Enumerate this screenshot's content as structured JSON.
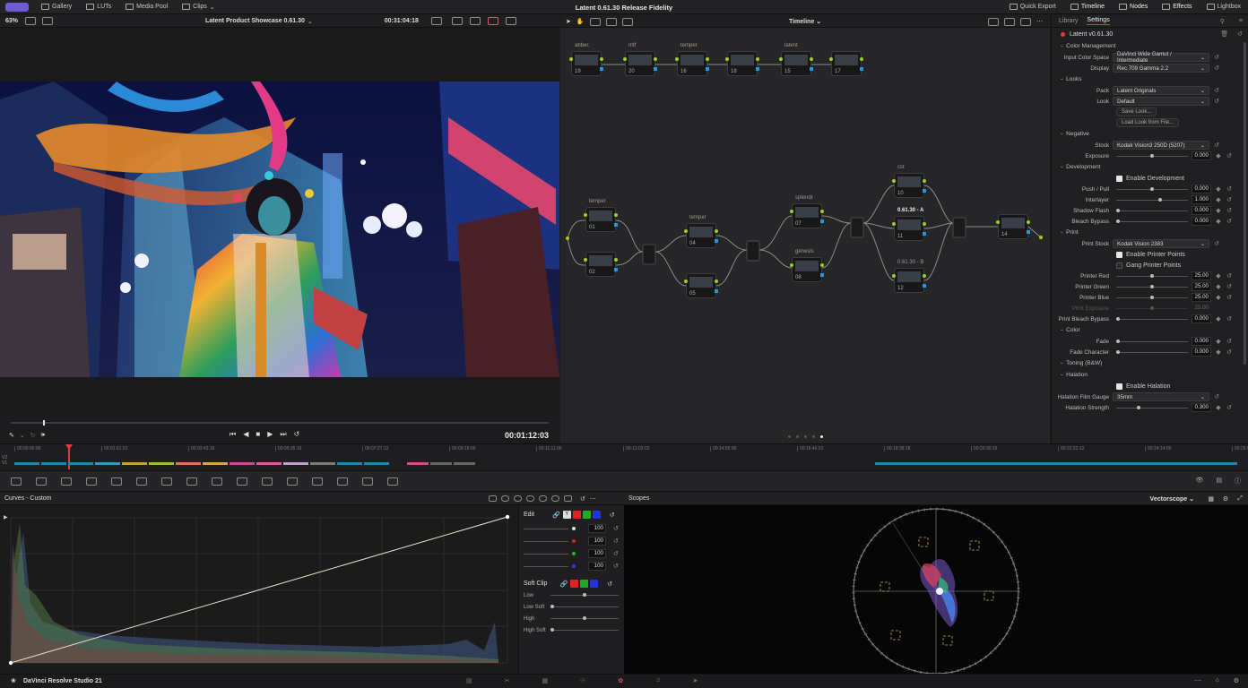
{
  "app": {
    "title": "Latent 0.61.30 Release Fidelity",
    "product": "DaVinci Resolve Studio 21"
  },
  "topnav": {
    "left": [
      {
        "label": "Gallery"
      },
      {
        "label": "LUTs"
      },
      {
        "label": "Media Pool"
      },
      {
        "label": "Clips"
      }
    ],
    "right": [
      {
        "label": "Quick Export"
      },
      {
        "label": "Timeline"
      },
      {
        "label": "Nodes"
      },
      {
        "label": "Effects"
      },
      {
        "label": "Lightbox"
      }
    ]
  },
  "viewer": {
    "zoom": "63%",
    "clip_name": "Latent Product Showcase 0.61.30",
    "timecode": "00:31:04:18",
    "playhead_timecode": "00:01:12:03",
    "timeline_label": "Timeline",
    "scrub_position": 0.06
  },
  "nodes": {
    "pager_dots": 5,
    "active_dot": 4,
    "items": [
      {
        "num": "19",
        "label": "abber."
      },
      {
        "num": "20",
        "label": "mtf"
      },
      {
        "num": "16",
        "label": "temper"
      },
      {
        "num": "18",
        "label": ""
      },
      {
        "num": "15",
        "label": "latent"
      },
      {
        "num": "17",
        "label": ""
      },
      {
        "num": "01",
        "label": "temper"
      },
      {
        "num": "02",
        "label": ""
      },
      {
        "num": "04",
        "label": "temper"
      },
      {
        "num": "05",
        "label": ""
      },
      {
        "num": "07",
        "label": "splendr"
      },
      {
        "num": "08",
        "label": "genesis"
      },
      {
        "num": "10",
        "label": "cst"
      },
      {
        "num": "11",
        "label": "0.61.30 - A"
      },
      {
        "num": "12",
        "label": "0.61.30 - B"
      },
      {
        "num": "14",
        "label": ""
      }
    ]
  },
  "settings": {
    "tabs": [
      {
        "label": "Library"
      },
      {
        "label": "Settings"
      }
    ],
    "plugin_name": "Latent v0.61.30",
    "sections": {
      "color_management": "Color Management",
      "looks": "Looks",
      "negative": "Negative",
      "development": "Development",
      "print": "Print",
      "color": "Color",
      "toning": "Toning (B&W)",
      "halation": "Halation"
    },
    "input_color_space": {
      "label": "Input Color Space",
      "value": "DaVinci Wide Gamut / Intermediate"
    },
    "display": {
      "label": "Display",
      "value": "Rec.709 Gamma 2.2"
    },
    "pack": {
      "label": "Pack",
      "value": "Latent Originals"
    },
    "look": {
      "label": "Look",
      "value": "Default"
    },
    "save_look": "Save Look...",
    "load_look": "Load Look from File...",
    "stock": {
      "label": "Stock",
      "value": "Kodak Vision3 250D (5207)"
    },
    "exposure": {
      "label": "Exposure",
      "value": "0.000",
      "level": 0.5
    },
    "enable_development": {
      "label": "Enable Development",
      "checked": true
    },
    "push_pull": {
      "label": "Push / Pull",
      "value": "0.000",
      "level": 0.5
    },
    "interlayer": {
      "label": "Interlayer",
      "value": "1.000",
      "level": 0.62
    },
    "shadow_flash": {
      "label": "Shadow Flash",
      "value": "0.000",
      "level": 0.0
    },
    "bleach_bypass": {
      "label": "Bleach Bypass",
      "value": "0.000",
      "level": 0.0
    },
    "print_stock": {
      "label": "Print Stock",
      "value": "Kodak Vision 2383"
    },
    "enable_printer_points": {
      "label": "Enable Printer Points",
      "checked": true
    },
    "gang_printer_points": {
      "label": "Gang Printer Points",
      "checked": false
    },
    "printer_red": {
      "label": "Printer Red",
      "value": "25.00",
      "level": 0.5
    },
    "printer_green": {
      "label": "Printer Green",
      "value": "25.00",
      "level": 0.5
    },
    "printer_blue": {
      "label": "Printer Blue",
      "value": "25.00",
      "level": 0.5
    },
    "print_exposure": {
      "label": "Print Exposure",
      "value": "25.00",
      "level": 0.5
    },
    "print_bleach_bypass": {
      "label": "Print Bleach Bypass",
      "value": "0.000",
      "level": 0.0
    },
    "fade": {
      "label": "Fade",
      "value": "0.000",
      "level": 0.0
    },
    "fade_character": {
      "label": "Fade Character",
      "value": "0.000",
      "level": 0.0
    },
    "enable_halation": {
      "label": "Enable Halation",
      "checked": true
    },
    "halation_film_gauge": {
      "label": "Halation Film Gauge",
      "value": "35mm"
    },
    "halation_strength": {
      "label": "Halation Strength",
      "value": "0.300",
      "level": 0.3
    }
  },
  "mini_timeline": {
    "ticks": [
      "00:00:00:00",
      "00:01:51:21",
      "00:03:43:16",
      "00:05:35:15",
      "00:07:27:12",
      "00:09:19:09",
      "00:11:11:06",
      "00:13:03:03",
      "00:14:55:00",
      "00:16:46:21",
      "00:18:38:18",
      "00:20:30:15",
      "00:22:22:12",
      "00:24:14:09",
      "00:26:06"
    ],
    "tracks": [
      "V2",
      "V1"
    ]
  },
  "curves": {
    "title": "Curves - Custom",
    "edit_label": "Edit",
    "channels": [
      {
        "value": "100",
        "color": "#e0e0e0"
      },
      {
        "value": "100",
        "color": "#d22"
      },
      {
        "value": "100",
        "color": "#2b2"
      },
      {
        "value": "100",
        "color": "#33f"
      }
    ],
    "soft_clip": "Soft Clip",
    "soft_rows": [
      {
        "label": "Low"
      },
      {
        "label": "Low Soft"
      },
      {
        "label": "High"
      },
      {
        "label": "High Soft"
      }
    ]
  },
  "scopes": {
    "title": "Scopes",
    "mode": "Vectorscope"
  },
  "colors": {
    "accent": "#6e5bd6",
    "node_output": "#9bd01f",
    "node_input": "#1e9ae0",
    "playhead": "#e23b3b"
  }
}
